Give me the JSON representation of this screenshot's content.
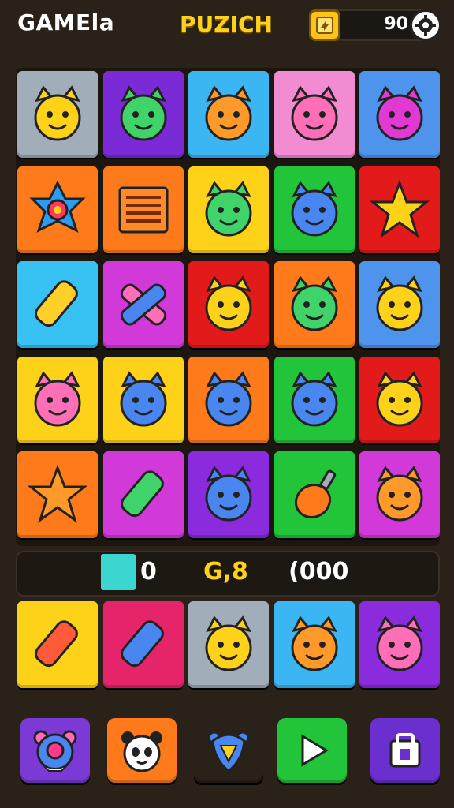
{
  "header": {
    "brand": "GAMEla",
    "title": "PUZICH",
    "coins": "90"
  },
  "colors": {
    "gray": "#a1adb9",
    "purple": "#7b2bd6",
    "sky": "#3cb6f2",
    "pink": "#f28bd1",
    "blue": "#4f94ec",
    "orange": "#ff7a1a",
    "yellow": "#ffd21a",
    "green": "#22c53a",
    "red": "#e21a1a",
    "cyan": "#38c2f4",
    "magenta": "#d13ad8",
    "violet": "#8a2bde",
    "crimson": "#e6246a"
  },
  "board": {
    "rows": [
      [
        {
          "bg": "gray",
          "icon": "yellow-lion-icon"
        },
        {
          "bg": "purple",
          "icon": "green-dinosaur-icon"
        },
        {
          "bg": "sky",
          "icon": "orange-bear-icon"
        },
        {
          "bg": "pink",
          "icon": "pink-cat-icon"
        },
        {
          "bg": "blue",
          "icon": "magenta-cat-icon"
        }
      ],
      [
        {
          "bg": "orange",
          "icon": "flower-icon"
        },
        {
          "bg": "orange",
          "icon": "striped-box-icon"
        },
        {
          "bg": "yellow",
          "icon": "green-frog-icon"
        },
        {
          "bg": "green",
          "icon": "blue-owl-icon"
        },
        {
          "bg": "red",
          "icon": "yellow-star-icon"
        }
      ],
      [
        {
          "bg": "cyan",
          "icon": "corn-icon"
        },
        {
          "bg": "magenta",
          "icon": "crossed-bandages-icon"
        },
        {
          "bg": "red",
          "icon": "yellow-bear-icon"
        },
        {
          "bg": "orange",
          "icon": "green-turtle-icon"
        },
        {
          "bg": "blue",
          "icon": "yellow-cat-icon"
        }
      ],
      [
        {
          "bg": "yellow",
          "icon": "pink-bear-icon"
        },
        {
          "bg": "yellow",
          "icon": "blue-cat-icon"
        },
        {
          "bg": "orange",
          "icon": "blue-hat-blob-icon"
        },
        {
          "bg": "green",
          "icon": "blue-bird-icon"
        },
        {
          "bg": "red",
          "icon": "yellow-heart-bear-icon"
        }
      ],
      [
        {
          "bg": "orange",
          "icon": "orange-star-icon"
        },
        {
          "bg": "magenta",
          "icon": "green-leaf-icon"
        },
        {
          "bg": "violet",
          "icon": "blue-monster-icon"
        },
        {
          "bg": "green",
          "icon": "orange-gourd-icon"
        },
        {
          "bg": "magenta",
          "icon": "orange-tiger-icon"
        }
      ]
    ],
    "bottom_row": [
      {
        "bg": "yellow",
        "icon": "red-crayon-icon"
      },
      {
        "bg": "crimson",
        "icon": "blue-rocket-icon"
      },
      {
        "bg": "gray",
        "icon": "yellow-pineapple-icon"
      },
      {
        "bg": "sky",
        "icon": "orange-fox-icon"
      },
      {
        "bg": "violet",
        "icon": "pink-cat-face-icon"
      }
    ]
  },
  "status": {
    "swatch_color": "#3bd6d0",
    "count": "0",
    "score": "G,8",
    "timer": "(000"
  },
  "toolbar": [
    {
      "icon": "bear-badge-icon",
      "bg": "#7b3ad6"
    },
    {
      "icon": "panda-icon",
      "bg": "#ff7a1a"
    },
    {
      "icon": "shield-bear-icon",
      "bg": "#2a2118"
    },
    {
      "icon": "play-icon",
      "bg": "#22c53a"
    },
    {
      "icon": "bag-icon",
      "bg": "#6b2fd0"
    }
  ]
}
